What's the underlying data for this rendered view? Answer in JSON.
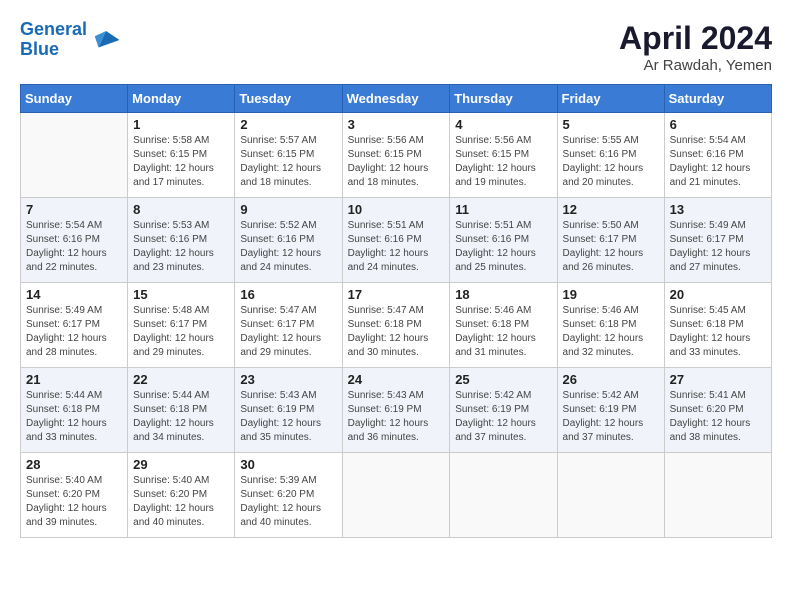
{
  "header": {
    "logo_line1": "General",
    "logo_line2": "Blue",
    "month_title": "April 2024",
    "location": "Ar Rawdah, Yemen"
  },
  "days_of_week": [
    "Sunday",
    "Monday",
    "Tuesday",
    "Wednesday",
    "Thursday",
    "Friday",
    "Saturday"
  ],
  "weeks": [
    [
      {
        "day": "",
        "info": ""
      },
      {
        "day": "1",
        "info": "Sunrise: 5:58 AM\nSunset: 6:15 PM\nDaylight: 12 hours\nand 17 minutes."
      },
      {
        "day": "2",
        "info": "Sunrise: 5:57 AM\nSunset: 6:15 PM\nDaylight: 12 hours\nand 18 minutes."
      },
      {
        "day": "3",
        "info": "Sunrise: 5:56 AM\nSunset: 6:15 PM\nDaylight: 12 hours\nand 18 minutes."
      },
      {
        "day": "4",
        "info": "Sunrise: 5:56 AM\nSunset: 6:15 PM\nDaylight: 12 hours\nand 19 minutes."
      },
      {
        "day": "5",
        "info": "Sunrise: 5:55 AM\nSunset: 6:16 PM\nDaylight: 12 hours\nand 20 minutes."
      },
      {
        "day": "6",
        "info": "Sunrise: 5:54 AM\nSunset: 6:16 PM\nDaylight: 12 hours\nand 21 minutes."
      }
    ],
    [
      {
        "day": "7",
        "info": "Sunrise: 5:54 AM\nSunset: 6:16 PM\nDaylight: 12 hours\nand 22 minutes."
      },
      {
        "day": "8",
        "info": "Sunrise: 5:53 AM\nSunset: 6:16 PM\nDaylight: 12 hours\nand 23 minutes."
      },
      {
        "day": "9",
        "info": "Sunrise: 5:52 AM\nSunset: 6:16 PM\nDaylight: 12 hours\nand 24 minutes."
      },
      {
        "day": "10",
        "info": "Sunrise: 5:51 AM\nSunset: 6:16 PM\nDaylight: 12 hours\nand 24 minutes."
      },
      {
        "day": "11",
        "info": "Sunrise: 5:51 AM\nSunset: 6:16 PM\nDaylight: 12 hours\nand 25 minutes."
      },
      {
        "day": "12",
        "info": "Sunrise: 5:50 AM\nSunset: 6:17 PM\nDaylight: 12 hours\nand 26 minutes."
      },
      {
        "day": "13",
        "info": "Sunrise: 5:49 AM\nSunset: 6:17 PM\nDaylight: 12 hours\nand 27 minutes."
      }
    ],
    [
      {
        "day": "14",
        "info": "Sunrise: 5:49 AM\nSunset: 6:17 PM\nDaylight: 12 hours\nand 28 minutes."
      },
      {
        "day": "15",
        "info": "Sunrise: 5:48 AM\nSunset: 6:17 PM\nDaylight: 12 hours\nand 29 minutes."
      },
      {
        "day": "16",
        "info": "Sunrise: 5:47 AM\nSunset: 6:17 PM\nDaylight: 12 hours\nand 29 minutes."
      },
      {
        "day": "17",
        "info": "Sunrise: 5:47 AM\nSunset: 6:18 PM\nDaylight: 12 hours\nand 30 minutes."
      },
      {
        "day": "18",
        "info": "Sunrise: 5:46 AM\nSunset: 6:18 PM\nDaylight: 12 hours\nand 31 minutes."
      },
      {
        "day": "19",
        "info": "Sunrise: 5:46 AM\nSunset: 6:18 PM\nDaylight: 12 hours\nand 32 minutes."
      },
      {
        "day": "20",
        "info": "Sunrise: 5:45 AM\nSunset: 6:18 PM\nDaylight: 12 hours\nand 33 minutes."
      }
    ],
    [
      {
        "day": "21",
        "info": "Sunrise: 5:44 AM\nSunset: 6:18 PM\nDaylight: 12 hours\nand 33 minutes."
      },
      {
        "day": "22",
        "info": "Sunrise: 5:44 AM\nSunset: 6:18 PM\nDaylight: 12 hours\nand 34 minutes."
      },
      {
        "day": "23",
        "info": "Sunrise: 5:43 AM\nSunset: 6:19 PM\nDaylight: 12 hours\nand 35 minutes."
      },
      {
        "day": "24",
        "info": "Sunrise: 5:43 AM\nSunset: 6:19 PM\nDaylight: 12 hours\nand 36 minutes."
      },
      {
        "day": "25",
        "info": "Sunrise: 5:42 AM\nSunset: 6:19 PM\nDaylight: 12 hours\nand 37 minutes."
      },
      {
        "day": "26",
        "info": "Sunrise: 5:42 AM\nSunset: 6:19 PM\nDaylight: 12 hours\nand 37 minutes."
      },
      {
        "day": "27",
        "info": "Sunrise: 5:41 AM\nSunset: 6:20 PM\nDaylight: 12 hours\nand 38 minutes."
      }
    ],
    [
      {
        "day": "28",
        "info": "Sunrise: 5:40 AM\nSunset: 6:20 PM\nDaylight: 12 hours\nand 39 minutes."
      },
      {
        "day": "29",
        "info": "Sunrise: 5:40 AM\nSunset: 6:20 PM\nDaylight: 12 hours\nand 40 minutes."
      },
      {
        "day": "30",
        "info": "Sunrise: 5:39 AM\nSunset: 6:20 PM\nDaylight: 12 hours\nand 40 minutes."
      },
      {
        "day": "",
        "info": ""
      },
      {
        "day": "",
        "info": ""
      },
      {
        "day": "",
        "info": ""
      },
      {
        "day": "",
        "info": ""
      }
    ]
  ]
}
